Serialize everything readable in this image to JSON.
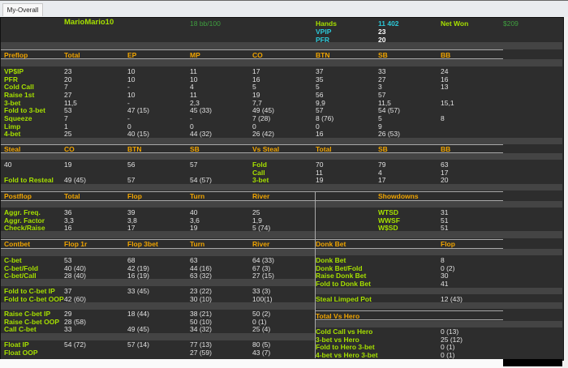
{
  "tabs": [
    {
      "label": "My-Overall",
      "active": true
    }
  ],
  "header": {
    "player": "MarioMario10",
    "winrate": "18 bb/100",
    "hands_label": "Hands",
    "hands": "11 402",
    "net_won_label": "Net Won",
    "net_won": "$209",
    "vpip_label": "VPIP",
    "vpip": "23",
    "pfr_label": "PFR",
    "pfr": "20"
  },
  "preflop": {
    "headers": [
      "Preflop",
      "Total",
      "EP",
      "MP",
      "CO",
      "BTN",
      "SB",
      "BB"
    ],
    "rows": [
      [
        "VP$IP",
        "23",
        "10",
        "11",
        "17",
        "37",
        "33",
        "24"
      ],
      [
        "PFR",
        "20",
        "10",
        "10",
        "16",
        "35",
        "27",
        "16"
      ],
      [
        "Cold Call",
        "7",
        "-",
        "4",
        "5",
        "5",
        "3",
        "13"
      ],
      [
        "Raise 1st",
        "27",
        "10",
        "11",
        "19",
        "56",
        "57",
        ""
      ],
      [
        "3-bet",
        "11,5",
        "-",
        "2,3",
        "7,7",
        "9,9",
        "11,5",
        "15,1"
      ],
      [
        "Fold to 3-bet",
        "53",
        "47 (15)",
        "45 (33)",
        "49 (45)",
        "57",
        "54 (57)",
        ""
      ],
      [
        "Squeeze",
        "7",
        "-",
        "-",
        "7 (28)",
        "8 (76)",
        "5",
        "8"
      ],
      [
        "Limp",
        "1",
        "0",
        "0",
        "0",
        "0",
        "9",
        ""
      ],
      [
        "4-bet",
        "25",
        "40 (15)",
        "44 (32)",
        "26 (42)",
        "16",
        "26 (53)",
        ""
      ]
    ]
  },
  "steal": {
    "headers": [
      "Steal",
      "CO",
      "BTN",
      "SB",
      "Vs Steal",
      "Total",
      "SB",
      "BB"
    ],
    "rows": [
      [
        "40",
        "19",
        "56",
        "57",
        "Fold",
        "70",
        "79",
        "63"
      ],
      [
        "",
        "",
        "",
        "",
        "Call",
        "11",
        "4",
        "17"
      ],
      [
        "Fold to Resteal",
        "49 (45)",
        "57",
        "54 (57)",
        "3-bet",
        "19",
        "17",
        "20"
      ]
    ]
  },
  "postflop": {
    "headers": [
      "Postflop",
      "Total",
      "Flop",
      "Turn",
      "River"
    ],
    "rows": [
      [
        "Aggr. Freq.",
        "36",
        "39",
        "40",
        "25"
      ],
      [
        "Aggr. Factor",
        "3,3",
        "3,8",
        "3,6",
        "1,9"
      ],
      [
        "Check/Raise",
        "16",
        "17",
        "19",
        "5 (74)"
      ]
    ]
  },
  "showdowns": {
    "header": "Showdowns",
    "rows": [
      [
        "WTSD",
        "31"
      ],
      [
        "WWSF",
        "51"
      ],
      [
        "W$SD",
        "51"
      ]
    ]
  },
  "contbet": {
    "headers": [
      "Contbet",
      "Flop 1r",
      "Flop 3bet",
      "Turn",
      "River"
    ],
    "groups": [
      [
        [
          "C-bet",
          "53",
          "68",
          "63",
          "64 (33)"
        ],
        [
          "C-bet/Fold",
          "40 (40)",
          "42 (19)",
          "44 (16)",
          "67 (3)"
        ],
        [
          "C-bet/Call",
          "28 (40)",
          "16 (19)",
          "63 (32)",
          "27 (15)"
        ]
      ],
      [
        [
          "Fold to C-bet IP",
          "37",
          "33 (45)",
          "23 (22)",
          "33 (3)"
        ],
        [
          "Fold to C-bet OOP",
          "42 (60)",
          "",
          "30 (10)",
          "100(1)"
        ]
      ],
      [
        [
          "Raise C-bet IP",
          "29",
          "18 (44)",
          "38 (21)",
          "50 (2)"
        ],
        [
          "Raise C-bet OOP",
          "28 (58)",
          "",
          "50 (10)",
          "0 (1)"
        ],
        [
          "Call C-bet",
          "33",
          "49 (45)",
          "34 (32)",
          "25 (4)"
        ]
      ],
      [
        [
          "Float IP",
          "54 (72)",
          "57 (14)",
          "77 (13)",
          "80 (5)"
        ],
        [
          "Float OOP",
          "",
          "",
          "27 (59)",
          "43 (7)"
        ]
      ]
    ]
  },
  "donk": {
    "headers": [
      "Donk Bet",
      "Flop"
    ],
    "rows": [
      [
        "Donk Bet",
        "8"
      ],
      [
        "Donk Bet/Fold",
        "0 (2)"
      ],
      [
        "Raise Donk Bet",
        "30"
      ],
      [
        "Fold to Donk Bet",
        "41"
      ]
    ],
    "steal_limped": [
      "Steal Limped Pot",
      "12 (43)"
    ]
  },
  "vs_hero": {
    "header": "Total Vs Hero",
    "rows": [
      [
        "Cold Call vs Hero",
        "0 (13)"
      ],
      [
        "3-bet vs Hero",
        "25 (12)"
      ],
      [
        "Fold to Hero 3-bet",
        "0 (1)"
      ],
      [
        "4-bet vs Hero 3-bet",
        "0 (1)"
      ]
    ]
  },
  "colors": {
    "panel": "#2d2d2d",
    "header": "#f0a400",
    "label": "#a6e000",
    "value": "#e2e2e2",
    "cyan": "#2cc8d8",
    "green": "#3f9f3f"
  }
}
